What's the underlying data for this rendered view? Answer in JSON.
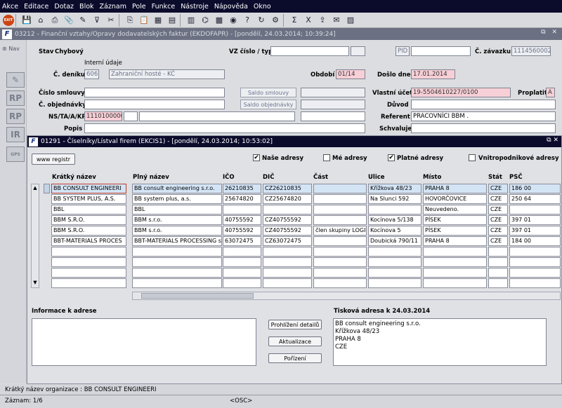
{
  "menu": [
    "Akce",
    "Editace",
    "Dotaz",
    "Blok",
    "Záznam",
    "Pole",
    "Funkce",
    "Nástroje",
    "Nápověda",
    "Okno"
  ],
  "toolbar": {
    "exit_label": "EXIT",
    "icons": [
      "save-icon",
      "home-icon",
      "print-icon",
      "attach-icon",
      "pencil-icon",
      "filter-icon",
      "scissors-icon",
      "copy-icon",
      "paste-icon",
      "grid-icon",
      "calculator-icon",
      "table-icon",
      "tree-icon",
      "block-icon",
      "globe-icon",
      "help-icon",
      "refresh-icon",
      "settings-icon",
      "sum-icon",
      "excel-icon",
      "export-icon",
      "mail-icon",
      "chart-icon"
    ]
  },
  "main_window": {
    "title": "03212 - Finanční vztahy/Opravy dodavatelských faktur (EKDOFAPR) - [pondělí, 24.03.2014; 10:39:24]",
    "controls": "⧉ ✕"
  },
  "sidebar": {
    "nav_label": "Nav",
    "icons": [
      {
        "name": "eraser-icon",
        "glyph": "✎"
      },
      {
        "name": "rp-icon-1",
        "glyph": "RP"
      },
      {
        "name": "rp-icon-2",
        "glyph": "RP"
      },
      {
        "name": "ir-icon",
        "glyph": "IR"
      },
      {
        "name": "gps-icon",
        "glyph": "GPS"
      }
    ]
  },
  "form": {
    "stav_label": "Stav",
    "stav_value": "Chybový",
    "vz_label": "VZ číslo / typ",
    "pid_label": "PID",
    "zavazek_label": "Č. závazku",
    "zavazek_value": "1114560002",
    "interni_udaje": "Interní údaje",
    "denik_label": "Č. deníku",
    "denik_code": "606",
    "denik_text": "Zahraniční hosté - KČ",
    "obdobi_label": "Období",
    "obdobi_value": "01/14",
    "doslo_label": "Došlo dne",
    "doslo_value": "17.01.2014",
    "smlouvy_label": "Číslo smlouvy",
    "saldo_smlouvy": "Saldo smlouvy",
    "vlastni_ucet_label": "Vlastní účet",
    "vlastni_ucet_value": "19-5504610227/0100",
    "proplatit_label": "Proplatit",
    "proplatit_value": "A",
    "objednavky_label": "Č. objednávky",
    "saldo_objednavky": "Saldo objednávky",
    "duvod_label": "Důvod",
    "ns_label": "NS/TA/A/KP",
    "ns_value": "1110100000",
    "referent_label": "Referent",
    "referent_value": "PRACOVNÍCI BBM .",
    "popis_label": "Popis",
    "schvaluje_label": "Schvaluje"
  },
  "sub_window": {
    "title": "01291 - Číselníky/Lístval firem (EKCIS1) - [pondělí, 24.03.2014; 10:53:02]",
    "www_button": "www registr",
    "checks": [
      {
        "label": "Naše adresy",
        "checked": "✔"
      },
      {
        "label": "Mé adresy",
        "checked": ""
      },
      {
        "label": "Platné adresy",
        "checked": "✔"
      },
      {
        "label": "Vnitropodnikové adresy",
        "checked": ""
      }
    ],
    "columns": [
      "Krátký název",
      "Plný název",
      "IČO",
      "DIČ",
      "Část",
      "Ulice",
      "Místo",
      "Stát",
      "PSČ"
    ],
    "rows": [
      [
        "BB CONSULT ENGINEERI",
        "BB consult engineering s.r.o.",
        "26210835",
        "CZ26210835",
        "",
        "Křížkova 48/23",
        "PRAHA 8",
        "CZE",
        "186 00"
      ],
      [
        "BB SYSTEM PLUS, A.S.",
        "BB system plus, a.s.",
        "25674820",
        "CZ25674820",
        "",
        "Na Slunci 592",
        "HOVORČOVICE",
        "CZE",
        "250 64"
      ],
      [
        "BBL",
        "BBL",
        "",
        "",
        "",
        "",
        "Neuvedeno.",
        "CZE",
        ""
      ],
      [
        "BBM S.R.O.",
        "BBM s.r.o.",
        "40755592",
        "CZ40755592",
        "",
        "Kocínova 5/138",
        "PÍSEK",
        "CZE",
        "397 01"
      ],
      [
        "BBM S.R.O.",
        "BBM s.r.o.",
        "40755592",
        "CZ40755592",
        "člen skupiny LOGIS",
        "Kocínova 5",
        "PÍSEK",
        "CZE",
        "397 01"
      ],
      [
        "BBT-MATERIALS PROCES",
        "BBT-MATERIALS PROCESSING s",
        "63072475",
        "CZ63072475",
        "",
        "Doubická 790/11",
        "PRAHA 8",
        "CZE",
        "184 00"
      ],
      [
        "",
        "",
        "",
        "",
        "",
        "",
        "",
        "",
        ""
      ],
      [
        "",
        "",
        "",
        "",
        "",
        "",
        "",
        "",
        ""
      ],
      [
        "",
        "",
        "",
        "",
        "",
        "",
        "",
        "",
        ""
      ],
      [
        "",
        "",
        "",
        "",
        "",
        "",
        "",
        "",
        ""
      ]
    ],
    "info_label": "Informace k adrese",
    "tiskova_label": "Tisková adresa k 24.03.2014",
    "tiskova_lines": [
      "BB consult engineering s.r.o.",
      "Křížkova 48/23",
      "PRAHA 8",
      "CZE"
    ],
    "btn_prohlizeni": "Prohlížení detailů",
    "btn_aktualizace": "Aktualizace",
    "btn_porizeni": "Pořízení"
  },
  "status": {
    "line1": "Krátký název organizace : BB CONSULT ENGINEERI",
    "line2": "Záznam: 1/6",
    "osc": "<OSC>"
  }
}
